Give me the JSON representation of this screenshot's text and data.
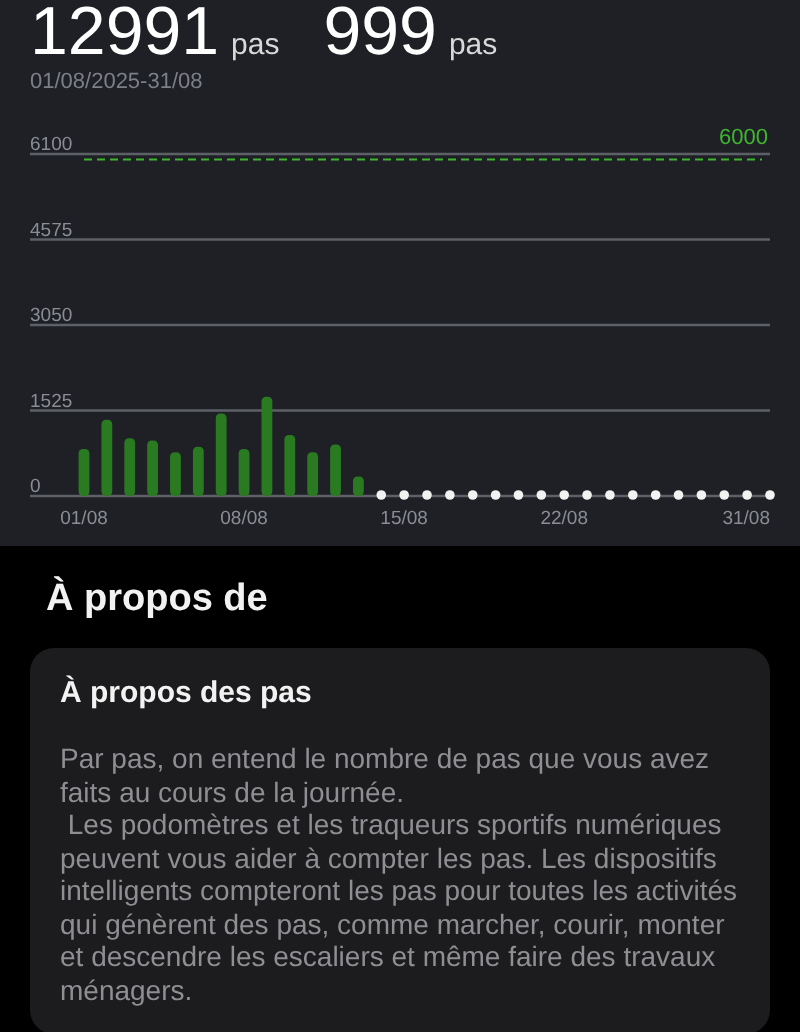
{
  "summary": {
    "stats": [
      {
        "value": "12991",
        "unit": "pas"
      },
      {
        "value": "999",
        "unit": "pas"
      }
    ],
    "date_range": "01/08/2025-31/08"
  },
  "chart": {
    "chart_data": {
      "type": "bar",
      "categories": [
        "01/08",
        null,
        null,
        null,
        null,
        null,
        null,
        "08/08",
        null,
        null,
        null,
        null,
        null,
        null,
        "15/08",
        null,
        null,
        null,
        null,
        null,
        null,
        "22/08",
        null,
        null,
        null,
        null,
        null,
        null,
        null,
        null,
        "31/08"
      ],
      "values": [
        840,
        1360,
        1030,
        990,
        780,
        880,
        1470,
        840,
        1770,
        1090,
        780,
        920,
        350,
        0,
        0,
        0,
        0,
        0,
        0,
        0,
        0,
        0,
        0,
        0,
        0,
        0,
        0,
        0,
        0,
        0,
        0
      ],
      "ylim": [
        0,
        6100
      ],
      "yticks": [
        0,
        1525,
        3050,
        4575,
        6100
      ],
      "grid": true,
      "ref_lines": [
        {
          "axis": "y",
          "value": 6000,
          "label": "6000",
          "color": "#3fb52f"
        }
      ]
    }
  },
  "about": {
    "heading": "À propos de",
    "card": {
      "title": "À propos des pas",
      "text": "Par pas, on entend le nombre de pas que vous avez faits au cours de la journée.\n Les podomètres et les traqueurs sportifs numériques peuvent vous aider à compter les pas. Les dispositifs intelligents compteront les pas pour toutes les activités qui génèrent des pas, comme marcher, courir, monter et descendre les escaliers et même faire des travaux ménagers."
    }
  }
}
